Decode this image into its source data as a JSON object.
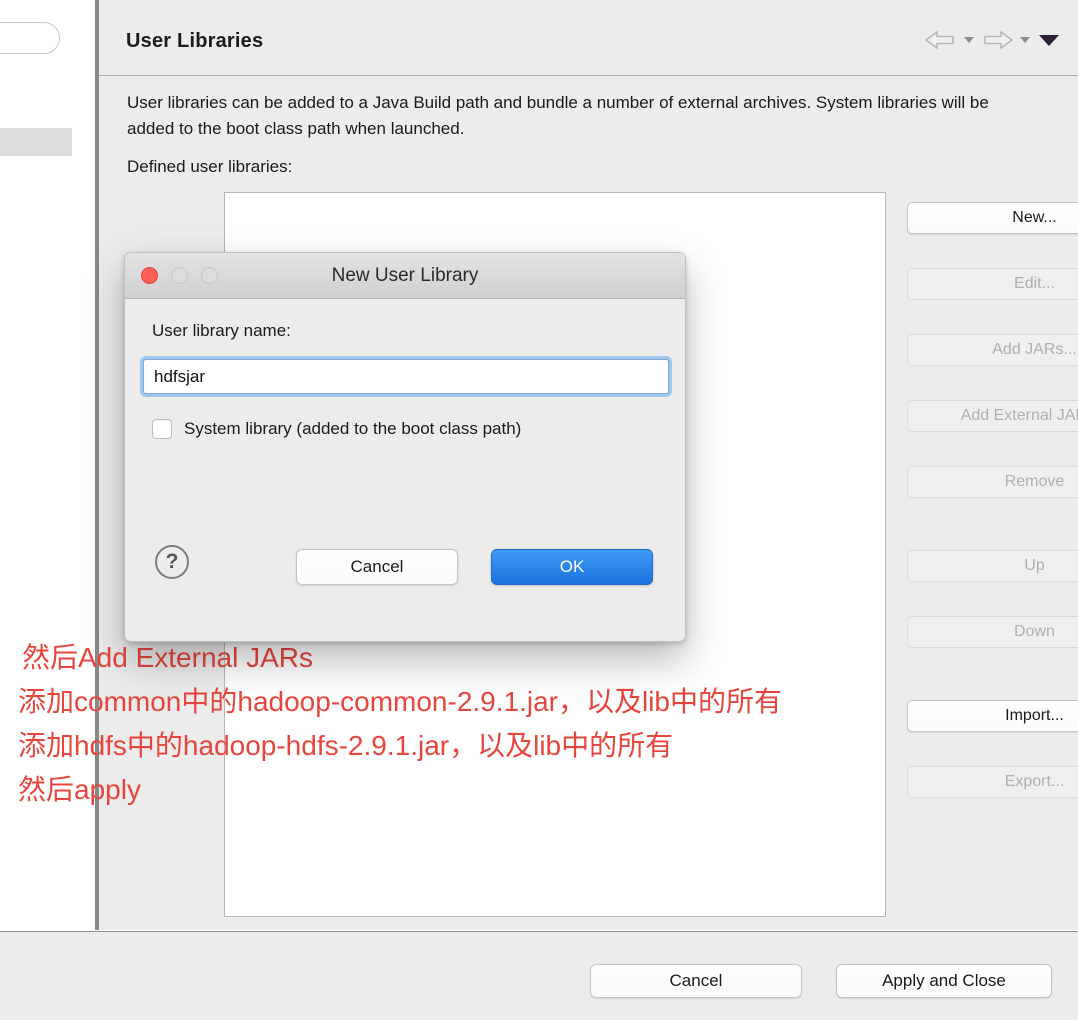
{
  "window": {
    "title": "User Libraries",
    "description": "User libraries can be added to a Java Build path and bundle a number of external archives. System libraries will be added to the boot class path when launched.",
    "sub_description": "Defined user libraries:"
  },
  "navigation": {
    "back_icon": "back-arrow-icon",
    "back_caret": "▾",
    "forward_icon": "forward-arrow-icon",
    "forward_caret": "▾",
    "menu_caret": "▼"
  },
  "side_buttons": [
    {
      "label": "New...",
      "enabled": true
    },
    {
      "label": "Edit...",
      "enabled": false
    },
    {
      "label": "Add JARs...",
      "enabled": false
    },
    {
      "label": "Add External JARs...",
      "enabled": false
    },
    {
      "label": "Remove",
      "enabled": false
    },
    {
      "label": "Up",
      "enabled": false
    },
    {
      "label": "Down",
      "enabled": false
    },
    {
      "label": "Import...",
      "enabled": true
    },
    {
      "label": "Export...",
      "enabled": false
    }
  ],
  "footer": {
    "cancel_label": "Cancel",
    "apply_label": "Apply and Close"
  },
  "dialog": {
    "title": "New User Library",
    "name_label": "User library name:",
    "name_value": "hdfsjar",
    "name_placeholder": "",
    "system_library_label": "System library (added to the boot class path)",
    "system_library_checked": false,
    "help_glyph": "?",
    "cancel_label": "Cancel",
    "ok_label": "OK",
    "accent_color": "#1c72e0",
    "close_dot_color": "#ff5f57"
  },
  "annotation": {
    "color": "#e8453c",
    "lines": [
      "然后Add External JARs",
      "添加common中的hadoop-common-2.9.1.jar，以及lib中的所有",
      "添加hdfs中的hadoop-hdfs-2.9.1.jar，以及lib中的所有",
      "然后apply"
    ]
  }
}
